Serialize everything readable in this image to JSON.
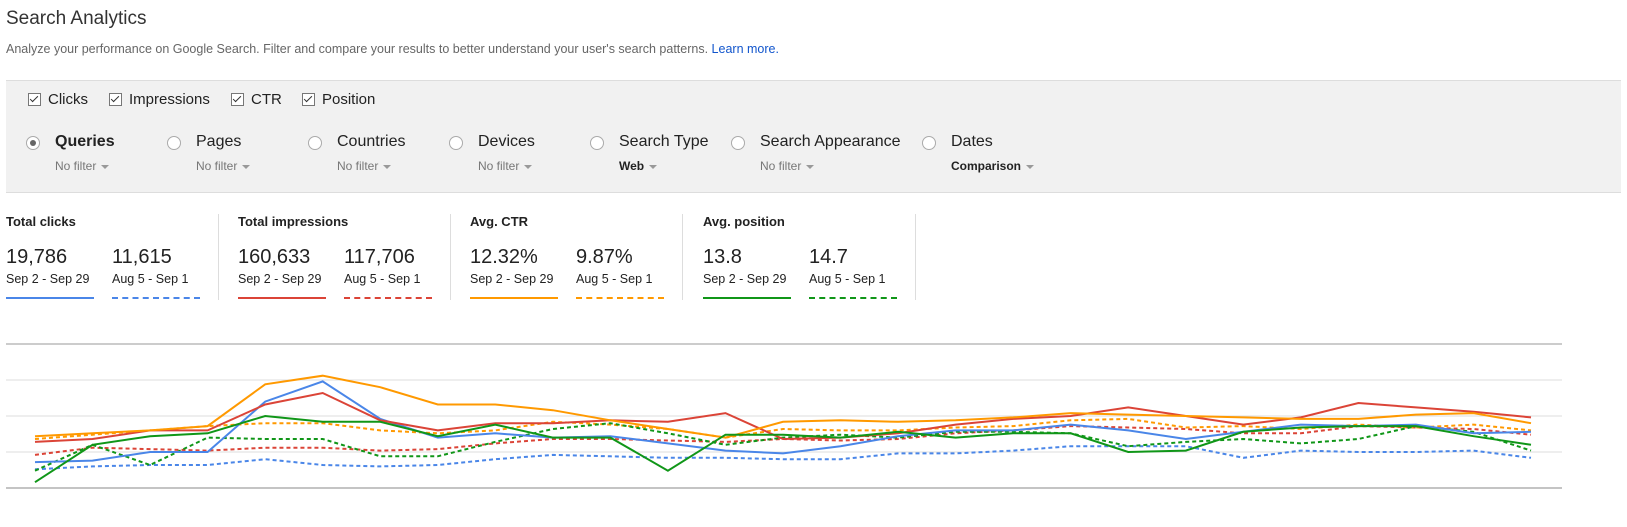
{
  "header": {
    "title": "Search Analytics",
    "description": "Analyze your performance on Google Search. Filter and compare your results to better understand your user's search patterns.",
    "learn_more": "Learn more."
  },
  "metrics": [
    {
      "label": "Clicks",
      "checked": true
    },
    {
      "label": "Impressions",
      "checked": true
    },
    {
      "label": "CTR",
      "checked": true
    },
    {
      "label": "Position",
      "checked": true
    }
  ],
  "dimensions": [
    {
      "label": "Queries",
      "filter": "No filter",
      "selected": true
    },
    {
      "label": "Pages",
      "filter": "No filter",
      "selected": false
    },
    {
      "label": "Countries",
      "filter": "No filter",
      "selected": false
    },
    {
      "label": "Devices",
      "filter": "No filter",
      "selected": false
    },
    {
      "label": "Search Type",
      "filter": "Web",
      "selected": false
    },
    {
      "label": "Search Appearance",
      "filter": "No filter",
      "selected": false
    },
    {
      "label": "Dates",
      "filter": "Comparison",
      "selected": false
    }
  ],
  "stats": [
    {
      "title": "Total clicks",
      "current": "19,786",
      "current_range": "Sep 2 - Sep 29",
      "previous": "11,615",
      "previous_range": "Aug 5 - Sep 1",
      "color": "#4a86e8"
    },
    {
      "title": "Total impressions",
      "current": "160,633",
      "current_range": "Sep 2 - Sep 29",
      "previous": "117,706",
      "previous_range": "Aug 5 - Sep 1",
      "color": "#db4437"
    },
    {
      "title": "Avg. CTR",
      "current": "12.32%",
      "current_range": "Sep 2 - Sep 29",
      "previous": "9.87%",
      "previous_range": "Aug 5 - Sep 1",
      "color": "#ff9900"
    },
    {
      "title": "Avg. position",
      "current": "13.8",
      "current_range": "Sep 2 - Sep 29",
      "previous": "14.7",
      "previous_range": "Aug 5 - Sep 1",
      "color": "#109618"
    }
  ],
  "chart_data": {
    "type": "line",
    "grid": true,
    "series": [
      {
        "name": "Total clicks",
        "period": "Sep 2 - Sep 29",
        "style": "solid",
        "color": "#4a86e8",
        "values": [
          18,
          19,
          25,
          25,
          60,
          74,
          48,
          35,
          38,
          35,
          36,
          31,
          26,
          24,
          29,
          36,
          40,
          40,
          44,
          40,
          34,
          39,
          44,
          43,
          44,
          38,
          39
        ]
      },
      {
        "name": "Total clicks",
        "period": "Aug 5 - Sep 1",
        "style": "dashed",
        "color": "#4a86e8",
        "values": [
          13,
          15,
          16,
          16,
          20,
          16,
          15,
          16,
          20,
          23,
          22,
          21,
          21,
          20,
          20,
          24,
          24,
          26,
          29,
          29,
          29,
          21,
          26,
          25,
          25,
          26,
          21
        ]
      },
      {
        "name": "Total impressions",
        "period": "Sep 2 - Sep 29",
        "style": "solid",
        "color": "#db4437",
        "values": [
          32,
          34,
          40,
          40,
          58,
          66,
          47,
          40,
          45,
          45,
          47,
          46,
          52,
          34,
          35,
          38,
          44,
          48,
          50,
          56,
          50,
          44,
          49,
          59,
          56,
          53,
          49
        ]
      },
      {
        "name": "Total impressions",
        "period": "Aug 5 - Sep 1",
        "style": "dashed",
        "color": "#db4437",
        "values": [
          23,
          28,
          27,
          26,
          28,
          28,
          26,
          27,
          31,
          34,
          34,
          33,
          32,
          34,
          33,
          34,
          38,
          40,
          43,
          42,
          41,
          38,
          38,
          43,
          42,
          41,
          37
        ]
      },
      {
        "name": "Avg. CTR",
        "period": "Sep 2 - Sep 29",
        "style": "solid",
        "color": "#ff9900",
        "values": [
          36,
          38,
          40,
          43,
          72,
          78,
          70,
          58,
          58,
          54,
          47,
          41,
          35,
          46,
          47,
          46,
          47,
          49,
          52,
          51,
          50,
          49,
          48,
          48,
          51,
          52,
          45
        ]
      },
      {
        "name": "Avg. CTR",
        "period": "Aug 5 - Sep 1",
        "style": "dashed",
        "color": "#ff9900",
        "values": [
          34,
          37,
          40,
          43,
          45,
          45,
          40,
          38,
          40,
          46,
          44,
          41,
          35,
          41,
          40,
          40,
          42,
          43,
          47,
          48,
          42,
          43,
          41,
          44,
          42,
          44,
          40
        ]
      },
      {
        "name": "Avg. position",
        "period": "Sep 2 - Sep 29",
        "style": "solid",
        "color": "#109618",
        "values": [
          4,
          30,
          36,
          38,
          50,
          46,
          46,
          36,
          44,
          35,
          35,
          12,
          37,
          37,
          35,
          39,
          35,
          38,
          38,
          25,
          26,
          39,
          42,
          43,
          43,
          36,
          30
        ]
      },
      {
        "name": "Avg. position",
        "period": "Aug 5 - Sep 1",
        "style": "dashed",
        "color": "#109618",
        "values": [
          12,
          30,
          16,
          35,
          34,
          34,
          22,
          22,
          32,
          41,
          45,
          38,
          30,
          35,
          37,
          35,
          39,
          39,
          38,
          29,
          32,
          34,
          31,
          34,
          43,
          39,
          26
        ]
      }
    ]
  }
}
